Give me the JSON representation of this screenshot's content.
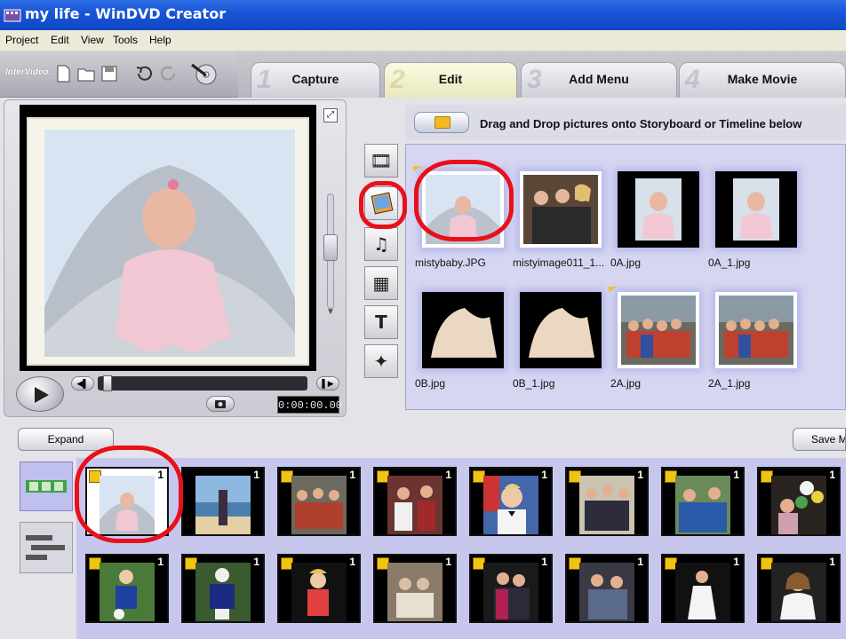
{
  "window": {
    "title": "my life - WinDVD Creator"
  },
  "menu": [
    "Project",
    "Edit",
    "View",
    "Tools",
    "Help"
  ],
  "toolbar": {
    "brand": "InterVideo."
  },
  "steps": [
    {
      "num": "1",
      "label": "Capture"
    },
    {
      "num": "2",
      "label": "Edit"
    },
    {
      "num": "3",
      "label": "Add Menu"
    },
    {
      "num": "4",
      "label": "Make Movie"
    }
  ],
  "player": {
    "timecode": "0:00:00.00"
  },
  "library": {
    "hint": "Drag and Drop pictures onto Storyboard or Timeline below",
    "items": [
      {
        "name": "mistybaby.JPG"
      },
      {
        "name": "mistyimage011_1..."
      },
      {
        "name": "0A.jpg"
      },
      {
        "name": "0A_1.jpg"
      },
      {
        "name": "0B.jpg"
      },
      {
        "name": "0B_1.jpg"
      },
      {
        "name": "2A.jpg"
      },
      {
        "name": "2A_1.jpg"
      }
    ]
  },
  "storyboard": {
    "expand_label": "Expand",
    "save_label": "Save M",
    "clip_number": "1"
  },
  "colors": {
    "annotation": "#e8101a",
    "titlebar": "#1a55d8",
    "library_bg": "#d6d6f2"
  }
}
